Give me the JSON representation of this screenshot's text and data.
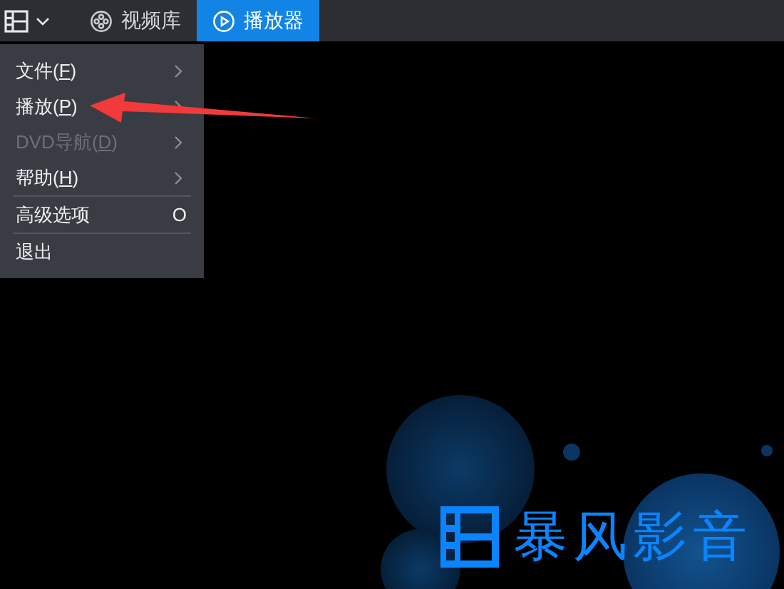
{
  "tabs": [
    {
      "label": "视频库",
      "kind": "reel",
      "selected": false
    },
    {
      "label": "播放器",
      "kind": "play",
      "selected": true
    }
  ],
  "menu": {
    "items": [
      {
        "kind": "submenu",
        "prefix": "文件(",
        "key": "F",
        "suffix": ")",
        "disabled": false,
        "separator_before": false
      },
      {
        "kind": "submenu",
        "prefix": "播放(",
        "key": "P",
        "suffix": ")",
        "disabled": false,
        "separator_before": false
      },
      {
        "kind": "submenu",
        "prefix": "DVD导航(",
        "key": "D",
        "suffix": ")",
        "disabled": true,
        "separator_before": false
      },
      {
        "kind": "submenu",
        "prefix": "帮助(",
        "key": "H",
        "suffix": ")",
        "disabled": false,
        "separator_before": false
      },
      {
        "kind": "shortcut",
        "prefix": "高级选项",
        "shortcut": "O",
        "disabled": false,
        "separator_before": true
      },
      {
        "kind": "plain",
        "prefix": "退出",
        "disabled": false,
        "separator_before": true
      }
    ]
  },
  "player": {
    "logo_text": "暴风影音"
  }
}
